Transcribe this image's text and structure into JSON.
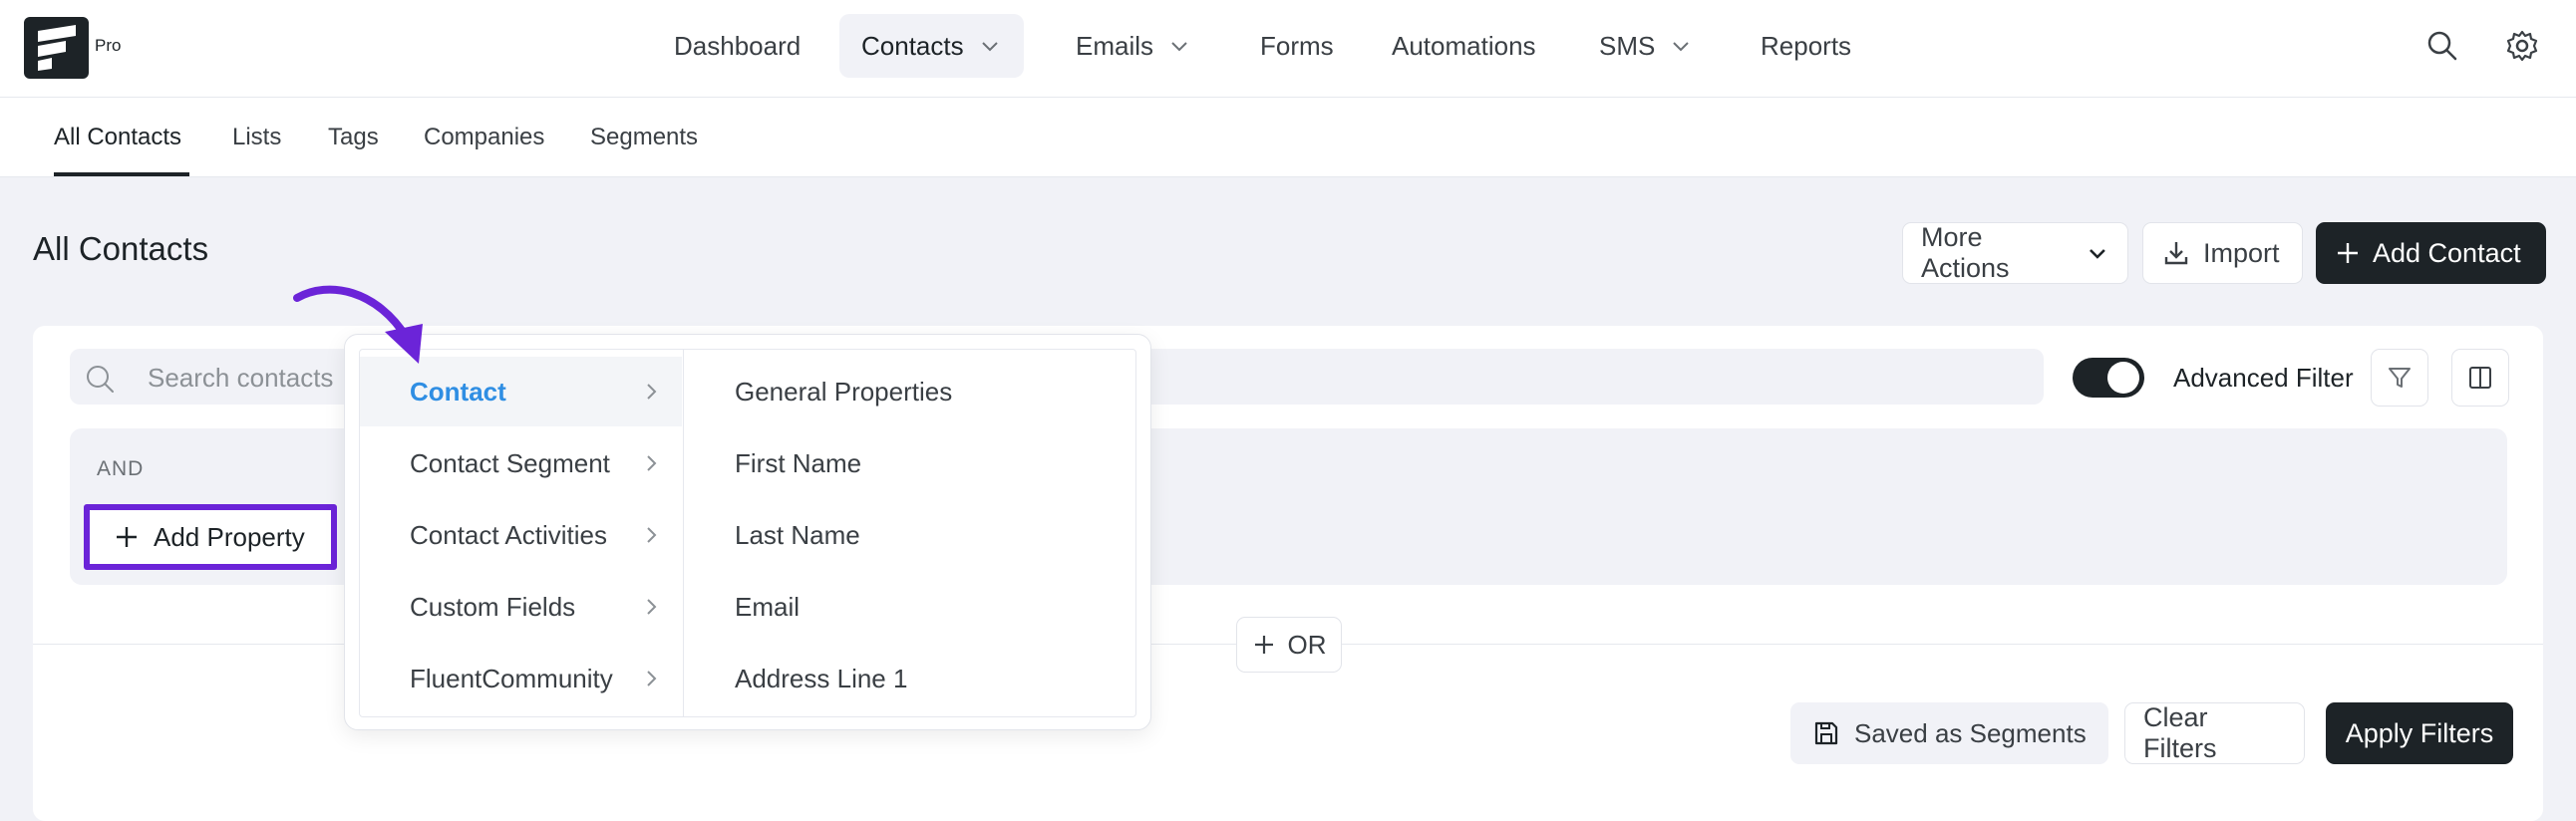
{
  "brand": {
    "badge": "Pro"
  },
  "nav": {
    "items": [
      {
        "label": "Dashboard",
        "has_dropdown": false,
        "active": false
      },
      {
        "label": "Contacts",
        "has_dropdown": true,
        "active": true
      },
      {
        "label": "Emails",
        "has_dropdown": true,
        "active": false
      },
      {
        "label": "Forms",
        "has_dropdown": false,
        "active": false
      },
      {
        "label": "Automations",
        "has_dropdown": false,
        "active": false
      },
      {
        "label": "SMS",
        "has_dropdown": true,
        "active": false
      },
      {
        "label": "Reports",
        "has_dropdown": false,
        "active": false
      }
    ],
    "icons": [
      "search-icon",
      "gear-icon"
    ]
  },
  "subnav": {
    "tabs": [
      {
        "label": "All Contacts",
        "active": true
      },
      {
        "label": "Lists",
        "active": false
      },
      {
        "label": "Tags",
        "active": false
      },
      {
        "label": "Companies",
        "active": false
      },
      {
        "label": "Segments",
        "active": false
      }
    ]
  },
  "page": {
    "title": "All Contacts",
    "actions": {
      "more_actions": "More Actions",
      "import": "Import",
      "add_contact": "Add Contact"
    }
  },
  "filters": {
    "search_placeholder": "Search contacts",
    "advanced_filter_label": "Advanced Filter",
    "advanced_filter_on": true,
    "group_operator": "AND",
    "add_property": "Add Property",
    "or_label": "OR",
    "saved_as_segments": "Saved as Segments",
    "clear_filters": "Clear Filters",
    "apply_filters": "Apply Filters"
  },
  "dropdown": {
    "categories": [
      {
        "label": "Contact",
        "active": true
      },
      {
        "label": "Contact Segment",
        "active": false
      },
      {
        "label": "Contact Activities",
        "active": false
      },
      {
        "label": "Custom Fields",
        "active": false
      },
      {
        "label": "FluentCommunity",
        "active": false
      }
    ],
    "properties": [
      "General Properties",
      "First Name",
      "Last Name",
      "Email",
      "Address Line 1"
    ]
  },
  "colors": {
    "accent_blue": "#2f8ee3",
    "annotation_purple": "#6b24d8",
    "dark": "#1d2327",
    "background": "#f1f2f7"
  }
}
